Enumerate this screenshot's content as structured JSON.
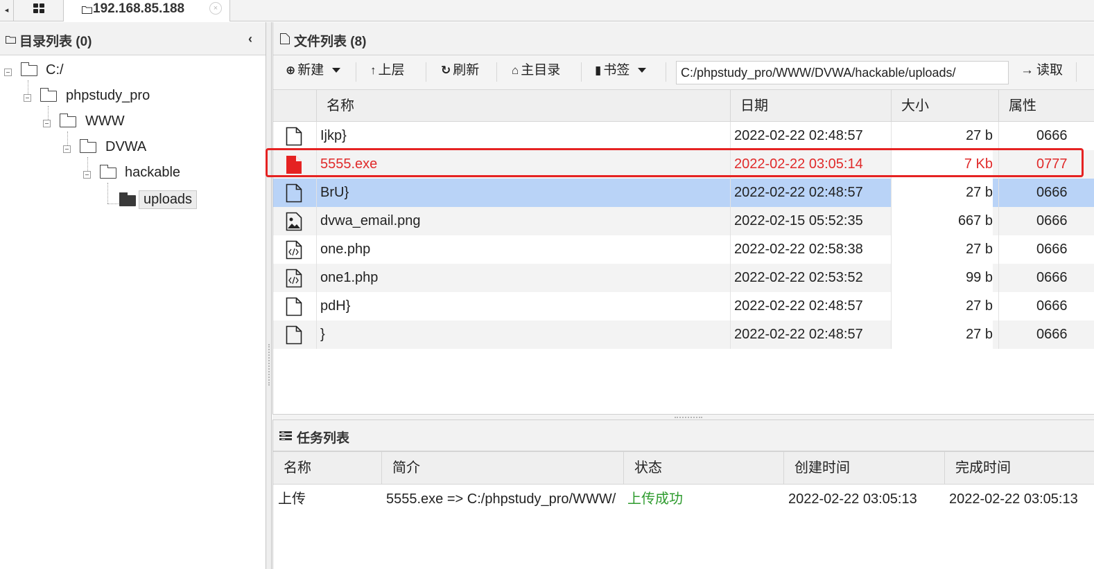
{
  "tabs": {
    "prev": "◂",
    "host": "192.168.85.188",
    "close": "×"
  },
  "dir_panel": {
    "title": "目录列表 (0)",
    "collapse": "‹",
    "tree": [
      {
        "label": "C:/"
      },
      {
        "label": "phpstudy_pro"
      },
      {
        "label": "WWW"
      },
      {
        "label": "DVWA"
      },
      {
        "label": "hackable"
      },
      {
        "label": "uploads",
        "selected": true
      }
    ]
  },
  "file_panel": {
    "title": "文件列表 (8)",
    "toolbar": {
      "new_label": "新建",
      "up_label": "上层",
      "refresh_label": "刷新",
      "home_label": "主目录",
      "bookmark_label": "书签",
      "path_value": "C:/phpstudy_pro/WWW/DVWA/hackable/uploads/",
      "read_label": "读取"
    },
    "columns": {
      "name": "名称",
      "date": "日期",
      "size": "大小",
      "attr": "属性"
    },
    "files": [
      {
        "icon": "file-icon",
        "name": "Ijkp}",
        "date": "2022-02-22 02:48:57",
        "size": "27 b",
        "attr": "0666"
      },
      {
        "icon": "exe-file-icon",
        "name": "5555.exe",
        "date": "2022-02-22 03:05:14",
        "size": "7 Kb",
        "attr": "0777"
      },
      {
        "icon": "file-icon",
        "name": "BrU}",
        "date": "2022-02-22 02:48:57",
        "size": "27 b",
        "attr": "0666"
      },
      {
        "icon": "image-file-icon",
        "name": "dvwa_email.png",
        "date": "2022-02-15 05:52:35",
        "size": "667 b",
        "attr": "0666"
      },
      {
        "icon": "code-file-icon",
        "name": "one.php",
        "date": "2022-02-22 02:58:38",
        "size": "27 b",
        "attr": "0666"
      },
      {
        "icon": "code-file-icon",
        "name": "one1.php",
        "date": "2022-02-22 02:53:52",
        "size": "99 b",
        "attr": "0666"
      },
      {
        "icon": "file-icon",
        "name": "pdH}",
        "date": "2022-02-22 02:48:57",
        "size": "27 b",
        "attr": "0666"
      },
      {
        "icon": "file-icon",
        "name": "}",
        "date": "2022-02-22 02:48:57",
        "size": "27 b",
        "attr": "0666"
      }
    ]
  },
  "task_panel": {
    "title": "任务列表",
    "columns": {
      "name": "名称",
      "desc": "简介",
      "status": "状态",
      "created": "创建时间",
      "finished": "完成时间"
    },
    "tasks": [
      {
        "name": "上传",
        "desc": "5555.exe => C:/phpstudy_pro/WWW/",
        "status": "上传成功",
        "created": "2022-02-22 03:05:13",
        "finished": "2022-02-22 03:05:13"
      }
    ]
  },
  "colors": {
    "highlight_border": "#e52222",
    "danger_text": "#e02a2a",
    "selected_row": "#b9d3f7",
    "success_text": "#2e9b2e"
  }
}
